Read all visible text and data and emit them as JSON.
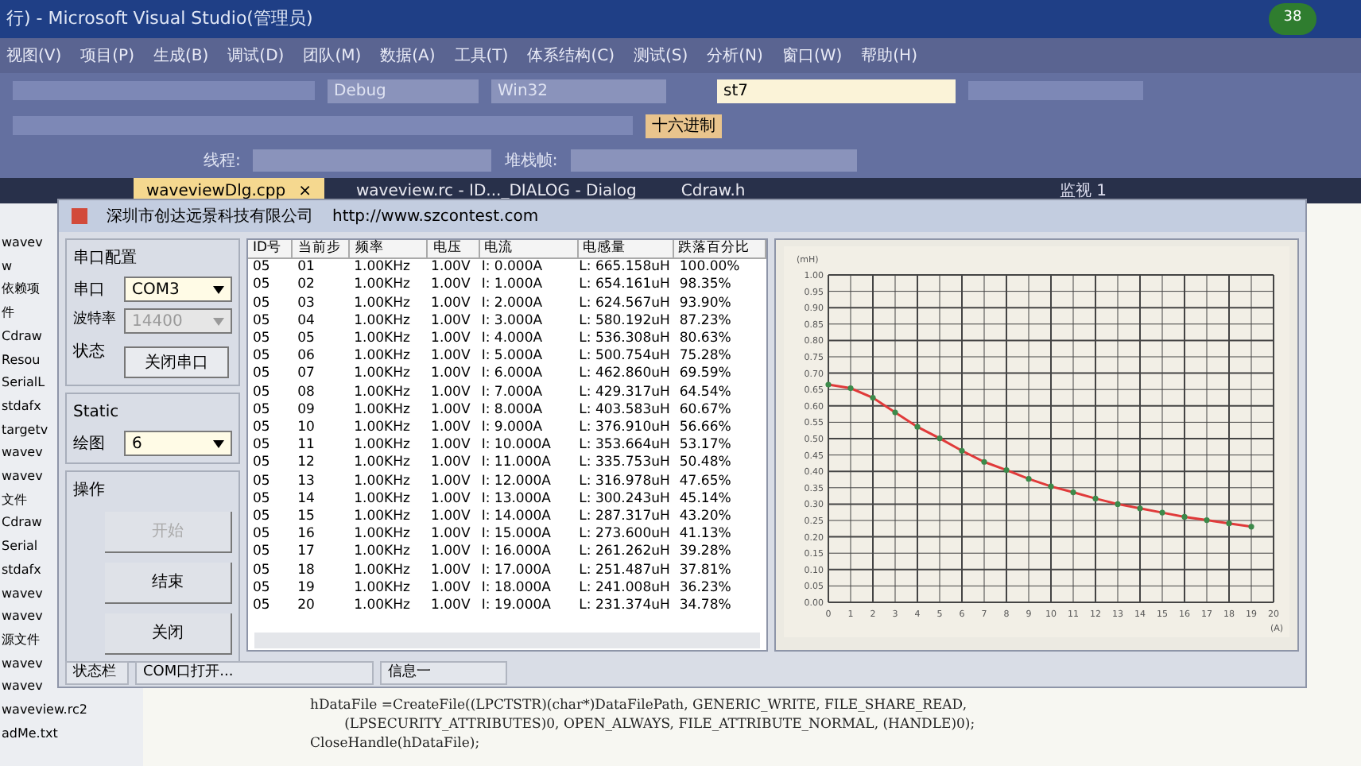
{
  "window": {
    "title": "行) - Microsoft Visual Studio(管理员)",
    "badge": "38"
  },
  "menu": [
    "视图(V)",
    "项目(P)",
    "生成(B)",
    "调试(D)",
    "团队(M)",
    "数据(A)",
    "工具(T)",
    "体系结构(C)",
    "测试(S)",
    "分析(N)",
    "窗口(W)",
    "帮助(H)"
  ],
  "toolbar": {
    "config": "Debug",
    "platform": "Win32",
    "target": "st7",
    "hex_button": "十六进制",
    "thread_label": "线程:",
    "stack_label": "堆栈帧:"
  },
  "tabs": [
    {
      "label": "waveviewDlg.cpp",
      "selected": true,
      "close": "×"
    },
    {
      "label": "waveview.rc - ID..._DIALOG - Dialog",
      "selected": false
    },
    {
      "label": "Cdraw.h",
      "selected": false
    }
  ],
  "watch_panel": {
    "title": "监视 1"
  },
  "solution_items": [
    "wavev",
    "w",
    "依赖项",
    "件",
    "Cdraw",
    "Resou",
    "SerialL",
    "stdafx",
    "targetv",
    "wavev",
    "wavev",
    "文件",
    "Cdraw",
    "Serial",
    "stdafx",
    "wavev",
    "wavev",
    "源文件",
    "wavev",
    "wavev",
    "waveview.rc2",
    "adMe.txt"
  ],
  "dialog": {
    "title": "深圳市创达远景科技有限公司",
    "url": "http://www.szcontest.com",
    "serial_group": {
      "title": "串口配置",
      "port_label": "串口",
      "port": "COM3",
      "baud_label": "波特率",
      "baud": "14400",
      "baud_disabled": true,
      "state_label": "状态",
      "toggle_button": "关闭串口"
    },
    "static_group": {
      "title": "Static",
      "plot_label": "绘图",
      "plot": "6"
    },
    "ops_group": {
      "title": "操作",
      "buttons": [
        {
          "label": "开始",
          "disabled": true
        },
        {
          "label": "结束",
          "disabled": false
        },
        {
          "label": "关闭",
          "disabled": false
        }
      ]
    },
    "table": {
      "columns": [
        "ID号",
        "当前步",
        "频率",
        "电压",
        "电流",
        "电感量",
        "跌落百分比"
      ],
      "rows": [
        [
          "05",
          "01",
          "1.00KHz",
          "1.00V",
          "I: 0.000A",
          "L: 665.158uH",
          "100.00%"
        ],
        [
          "05",
          "02",
          "1.00KHz",
          "1.00V",
          "I: 1.000A",
          "L: 654.161uH",
          "98.35%"
        ],
        [
          "05",
          "03",
          "1.00KHz",
          "1.00V",
          "I: 2.000A",
          "L: 624.567uH",
          "93.90%"
        ],
        [
          "05",
          "04",
          "1.00KHz",
          "1.00V",
          "I: 3.000A",
          "L: 580.192uH",
          "87.23%"
        ],
        [
          "05",
          "05",
          "1.00KHz",
          "1.00V",
          "I: 4.000A",
          "L: 536.308uH",
          "80.63%"
        ],
        [
          "05",
          "06",
          "1.00KHz",
          "1.00V",
          "I: 5.000A",
          "L: 500.754uH",
          "75.28%"
        ],
        [
          "05",
          "07",
          "1.00KHz",
          "1.00V",
          "I: 6.000A",
          "L: 462.860uH",
          "69.59%"
        ],
        [
          "05",
          "08",
          "1.00KHz",
          "1.00V",
          "I: 7.000A",
          "L: 429.317uH",
          "64.54%"
        ],
        [
          "05",
          "09",
          "1.00KHz",
          "1.00V",
          "I: 8.000A",
          "L: 403.583uH",
          "60.67%"
        ],
        [
          "05",
          "10",
          "1.00KHz",
          "1.00V",
          "I: 9.000A",
          "L: 376.910uH",
          "56.66%"
        ],
        [
          "05",
          "11",
          "1.00KHz",
          "1.00V",
          "I: 10.000A",
          "L: 353.664uH",
          "53.17%"
        ],
        [
          "05",
          "12",
          "1.00KHz",
          "1.00V",
          "I: 11.000A",
          "L: 335.753uH",
          "50.48%"
        ],
        [
          "05",
          "13",
          "1.00KHz",
          "1.00V",
          "I: 12.000A",
          "L: 316.978uH",
          "47.65%"
        ],
        [
          "05",
          "14",
          "1.00KHz",
          "1.00V",
          "I: 13.000A",
          "L: 300.243uH",
          "45.14%"
        ],
        [
          "05",
          "15",
          "1.00KHz",
          "1.00V",
          "I: 14.000A",
          "L: 287.317uH",
          "43.20%"
        ],
        [
          "05",
          "16",
          "1.00KHz",
          "1.00V",
          "I: 15.000A",
          "L: 273.600uH",
          "41.13%"
        ],
        [
          "05",
          "17",
          "1.00KHz",
          "1.00V",
          "I: 16.000A",
          "L: 261.262uH",
          "39.28%"
        ],
        [
          "05",
          "18",
          "1.00KHz",
          "1.00V",
          "I: 17.000A",
          "L: 251.487uH",
          "37.81%"
        ],
        [
          "05",
          "19",
          "1.00KHz",
          "1.00V",
          "I: 18.000A",
          "L: 241.008uH",
          "36.23%"
        ],
        [
          "05",
          "20",
          "1.00KHz",
          "1.00V",
          "I: 19.000A",
          "L: 231.374uH",
          "34.78%"
        ]
      ]
    },
    "chart_data": {
      "type": "line",
      "xlabel": "(A)",
      "ylabel": "(mH)",
      "x": [
        0,
        1,
        2,
        3,
        4,
        5,
        6,
        7,
        8,
        9,
        10,
        11,
        12,
        13,
        14,
        15,
        16,
        17,
        18,
        19
      ],
      "grid": true,
      "series": [
        {
          "color": "#e03a3a",
          "marker": "circle",
          "values": [
            0.665,
            0.654,
            0.625,
            0.58,
            0.536,
            0.501,
            0.463,
            0.429,
            0.404,
            0.377,
            0.354,
            0.336,
            0.317,
            0.3,
            0.287,
            0.274,
            0.261,
            0.251,
            0.241,
            0.231
          ]
        }
      ],
      "xlim": [
        0,
        20
      ],
      "ylim": [
        0,
        1
      ],
      "xticks": [
        0,
        1,
        2,
        3,
        4,
        5,
        6,
        7,
        8,
        9,
        10,
        11,
        12,
        13,
        14,
        15,
        16,
        17,
        18,
        19,
        20
      ],
      "yticks": [
        {
          "value": 0,
          "label": "0.00"
        },
        {
          "value": 0.05,
          "label": "0.05"
        },
        {
          "value": 0.1,
          "label": "0.10"
        },
        {
          "value": 0.15,
          "label": "0.15"
        },
        {
          "value": 0.2,
          "label": "0.20"
        },
        {
          "value": 0.25,
          "label": "0.25"
        },
        {
          "value": 0.3,
          "label": "0.30"
        },
        {
          "value": 0.35,
          "label": "0.35"
        },
        {
          "value": 0.4,
          "label": "0.40"
        },
        {
          "value": 0.45,
          "label": "0.45"
        },
        {
          "value": 0.5,
          "label": "0.50"
        },
        {
          "value": 0.55,
          "label": "0.55"
        },
        {
          "value": 0.6,
          "label": "0.60"
        },
        {
          "value": 0.65,
          "label": "0.65"
        },
        {
          "value": 0.7,
          "label": "0.70"
        },
        {
          "value": 0.75,
          "label": "0.75"
        },
        {
          "value": 0.8,
          "label": "0.80"
        },
        {
          "value": 0.85,
          "label": "0.85"
        },
        {
          "value": 0.9,
          "label": "0.90"
        },
        {
          "value": 0.95,
          "label": "0.95"
        },
        {
          "value": 1,
          "label": "1.00"
        }
      ]
    },
    "status_bar": [
      "状态栏",
      "COM口打开...",
      "信息一"
    ]
  },
  "code_lines": [
    "hDataFile =CreateFile((LPCTSTR)(char*)DataFilePath, GENERIC_WRITE, FILE_SHARE_READ,",
    "        (LPSECURITY_ATTRIBUTES)0, OPEN_ALWAYS, FILE_ATTRIBUTE_NORMAL, (HANDLE)0);",
    "CloseHandle(hDataFile);"
  ]
}
